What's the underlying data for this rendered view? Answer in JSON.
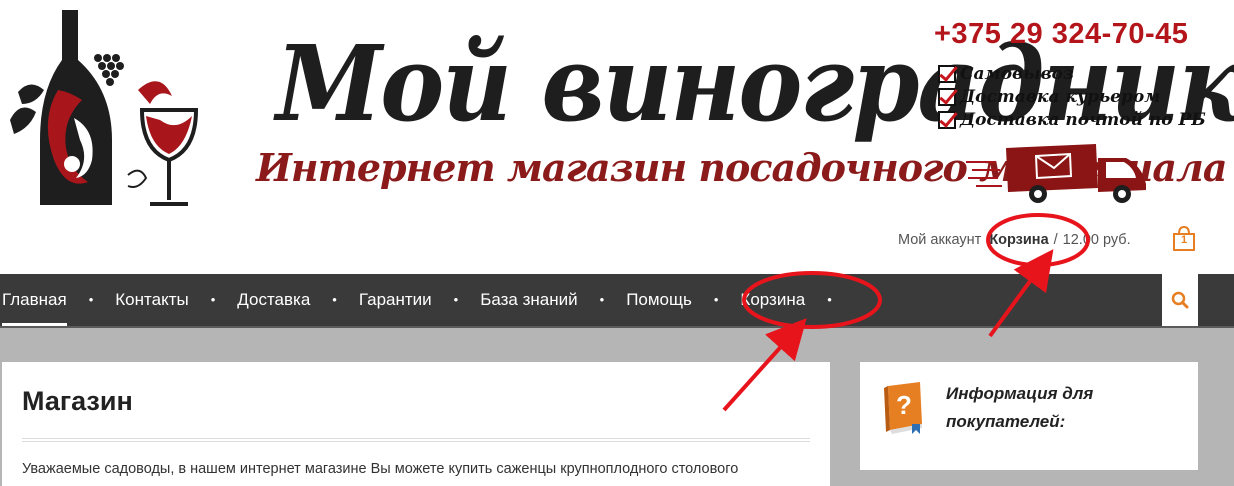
{
  "header": {
    "brand_title": "Мой виноградник",
    "brand_subtitle": "Интернет магазин посадочного материала",
    "phone": "+375 29 324-70-45",
    "features": [
      "Самовывоз",
      "Доставка курьером",
      "Доставка почтой по РБ"
    ]
  },
  "account": {
    "my_account": "Мой аккаунт",
    "cart_label": "Корзина",
    "separator": "/",
    "cart_total": "12.00 руб.",
    "cart_count": "1"
  },
  "nav": {
    "items": [
      "Главная",
      "Контакты",
      "Доставка",
      "Гарантии",
      "База знаний",
      "Помощь",
      "Корзина"
    ]
  },
  "main": {
    "title": "Магазин",
    "text": "Уважаемые садоводы, в нашем интернет магазине Вы можете купить саженцы крупноплодного столового"
  },
  "sidebar": {
    "info_title": "Информация для покупателей:"
  },
  "colors": {
    "brand_red": "#b3151b",
    "nav_bg": "#3a3a3a",
    "annotation": "#e8141c",
    "accent_orange": "#e67e22"
  }
}
